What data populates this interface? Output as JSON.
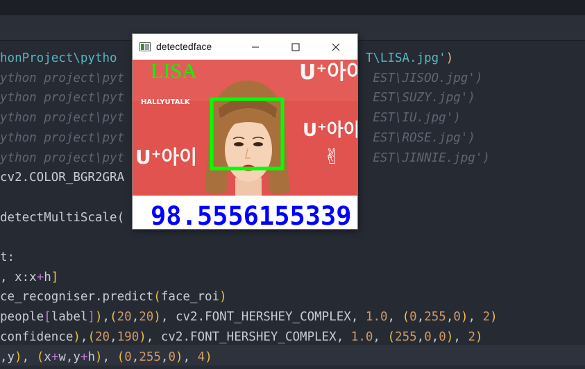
{
  "editor": {
    "lines": [
      {
        "t": [
          [
            "cyan",
            "honProject\\pytho"
          ],
          [
            "hide",
            "                                  "
          ],
          [
            "cyan",
            "T\\LISA.jpg'"
          ],
          [
            "yel",
            ")"
          ]
        ]
      },
      {
        "t": [
          [
            "cmt",
            "ython project\\pyt                                  EST\\JISOO.jpg')"
          ]
        ]
      },
      {
        "t": [
          [
            "cmt",
            "ython project\\pyt                                  EST\\SUZY.jpg')"
          ]
        ]
      },
      {
        "t": [
          [
            "cmt",
            "ython project\\pyt                                  EST\\IU.jpg')"
          ]
        ]
      },
      {
        "t": [
          [
            "cmt",
            "ython project\\pyt                                  EST\\ROSE.jpg')"
          ]
        ]
      },
      {
        "t": [
          [
            "cmt",
            "ython project\\pyt                                  EST\\JINNIE.jpg')"
          ]
        ]
      },
      {
        "t": [
          [
            "def",
            "cv2.COLOR_BGR2GRA"
          ]
        ]
      },
      {
        "t": [
          [
            "def",
            ""
          ]
        ]
      },
      {
        "t": [
          [
            "def",
            "detectMultiScale("
          ]
        ]
      },
      {
        "t": [
          [
            "def",
            ""
          ]
        ]
      },
      {
        "t": [
          [
            "def",
            "t:"
          ]
        ]
      },
      {
        "t": [
          [
            "def",
            ", x:x"
          ],
          [
            "pur",
            "+"
          ],
          [
            "def",
            "h"
          ],
          [
            "gold",
            "]"
          ]
        ]
      },
      {
        "t": [
          [
            "def",
            "ce_recogniser.predict"
          ],
          [
            "gold",
            "("
          ],
          [
            "def",
            "face_roi"
          ],
          [
            "gold",
            ")"
          ]
        ]
      },
      {
        "t": [
          [
            "def",
            "people"
          ],
          [
            "pur",
            "["
          ],
          [
            "def",
            "label"
          ],
          [
            "pur",
            "]"
          ],
          [
            "gold",
            ")"
          ],
          [
            "def",
            ","
          ],
          [
            "gold",
            "("
          ],
          [
            "ora",
            "20"
          ],
          [
            "def",
            ","
          ],
          [
            "ora",
            "20"
          ],
          [
            "gold",
            ")"
          ],
          [
            "def",
            ", cv2.FONT_HERSHEY_COMPLEX, "
          ],
          [
            "ora",
            "1.0"
          ],
          [
            "def",
            ", "
          ],
          [
            "gold",
            "("
          ],
          [
            "ora",
            "0"
          ],
          [
            "def",
            ","
          ],
          [
            "ora",
            "255"
          ],
          [
            "def",
            ","
          ],
          [
            "ora",
            "0"
          ],
          [
            "gold",
            ")"
          ],
          [
            "def",
            ", "
          ],
          [
            "ora",
            "2"
          ],
          [
            "gold",
            ")"
          ]
        ]
      },
      {
        "t": [
          [
            "def",
            "confidence"
          ],
          [
            "gold",
            ")"
          ],
          [
            "def",
            ","
          ],
          [
            "gold",
            "("
          ],
          [
            "ora",
            "20"
          ],
          [
            "def",
            ","
          ],
          [
            "ora",
            "190"
          ],
          [
            "gold",
            ")"
          ],
          [
            "def",
            ", cv2.FONT_HERSHEY_COMPLEX, "
          ],
          [
            "ora",
            "1.0"
          ],
          [
            "def",
            ", "
          ],
          [
            "gold",
            "("
          ],
          [
            "ora",
            "255"
          ],
          [
            "def",
            ","
          ],
          [
            "ora",
            "0"
          ],
          [
            "def",
            ","
          ],
          [
            "ora",
            "0"
          ],
          [
            "gold",
            ")"
          ],
          [
            "def",
            ", "
          ],
          [
            "ora",
            "2"
          ],
          [
            "gold",
            ")"
          ]
        ]
      },
      {
        "t": [
          [
            "def",
            ",y"
          ],
          [
            "gold",
            ")"
          ],
          [
            "def",
            ", "
          ],
          [
            "gold",
            "("
          ],
          [
            "def",
            "x"
          ],
          [
            "pur",
            "+"
          ],
          [
            "def",
            "w,y"
          ],
          [
            "pur",
            "+"
          ],
          [
            "def",
            "h"
          ],
          [
            "gold",
            ")"
          ],
          [
            "def",
            ", "
          ],
          [
            "gold",
            "("
          ],
          [
            "ora",
            "0"
          ],
          [
            "def",
            ","
          ],
          [
            "ora",
            "255"
          ],
          [
            "def",
            ","
          ],
          [
            "ora",
            "0"
          ],
          [
            "gold",
            ")"
          ],
          [
            "def",
            ", "
          ],
          [
            "ora",
            "4"
          ],
          [
            "gold",
            ")"
          ]
        ]
      }
    ]
  },
  "window": {
    "title": "detectedface",
    "buttons": [
      "minimize-icon",
      "maximize-icon",
      "close-icon"
    ]
  },
  "image": {
    "name_label": "LISA",
    "confidence_label": "98.5556155339",
    "watermark": "HALLYUTALK",
    "logo_text": "U⁺아이",
    "colors": {
      "name": "#00ff00",
      "confidence": "#0000ff",
      "box": "#00ff00",
      "background": "#e0534f"
    }
  }
}
